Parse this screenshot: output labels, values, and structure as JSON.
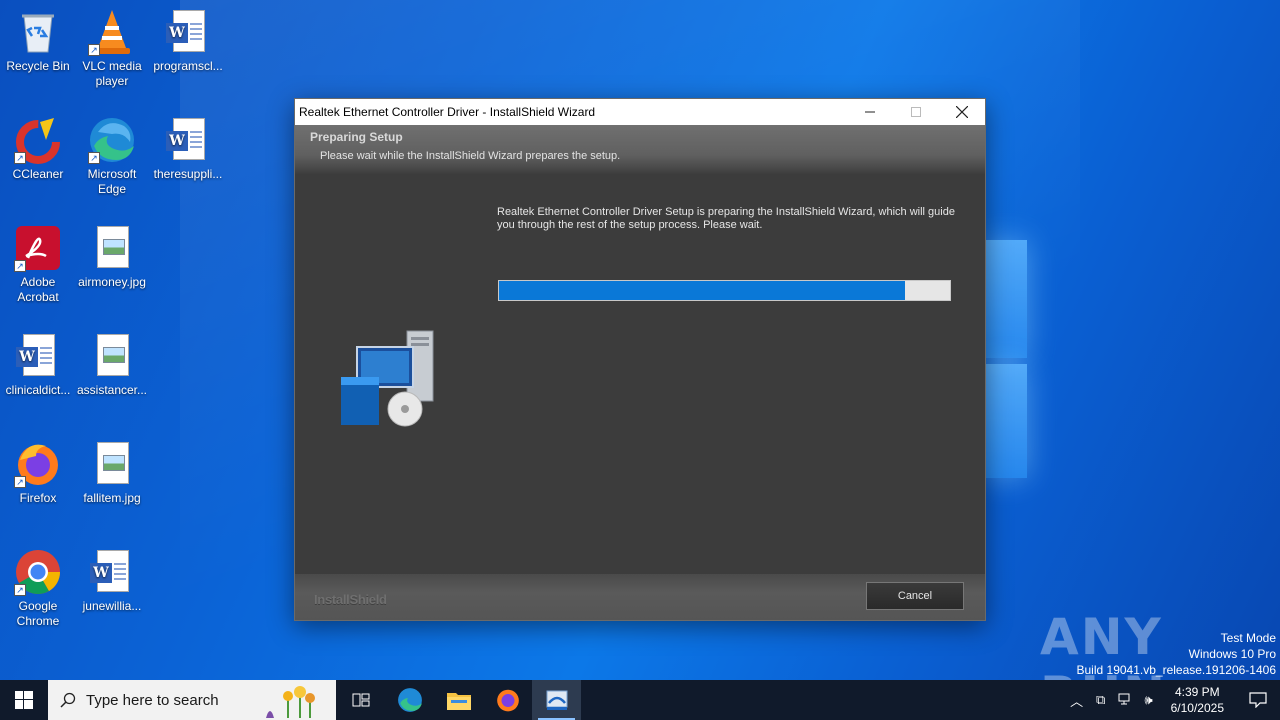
{
  "desktop": {
    "icons": [
      {
        "label": "Recycle Bin"
      },
      {
        "label": "VLC media player"
      },
      {
        "label": "programscl..."
      },
      {
        "label": "CCleaner"
      },
      {
        "label": "Microsoft Edge"
      },
      {
        "label": "theresuppli..."
      },
      {
        "label": "Adobe Acrobat"
      },
      {
        "label": "airmoney.jpg"
      },
      {
        "label": "clinicaldict..."
      },
      {
        "label": "assistancer..."
      },
      {
        "label": "Firefox"
      },
      {
        "label": "fallitem.jpg"
      },
      {
        "label": "Google Chrome"
      },
      {
        "label": "junewillia..."
      }
    ]
  },
  "dialog": {
    "title": "Realtek Ethernet Controller Driver - InstallShield Wizard",
    "header_title": "Preparing Setup",
    "header_subtitle": "Please wait while the InstallShield Wizard prepares the setup.",
    "message": "Realtek Ethernet Controller Driver Setup is preparing the InstallShield Wizard, which will guide you through the rest of the setup process. Please wait.",
    "progress_percent": 90,
    "brand": "InstallShield",
    "cancel_label": "Cancel"
  },
  "watermark": {
    "brand": "ANY RUN",
    "line1": "Test Mode",
    "line2": "Windows 10 Pro",
    "line3": "Build 19041.vb_release.191206-1406"
  },
  "taskbar": {
    "search_placeholder": "Type here to search",
    "time": "4:39 PM",
    "date": "6/10/2025"
  },
  "colors": {
    "accent": "#0a78d7",
    "taskbar": "#101a2b"
  }
}
